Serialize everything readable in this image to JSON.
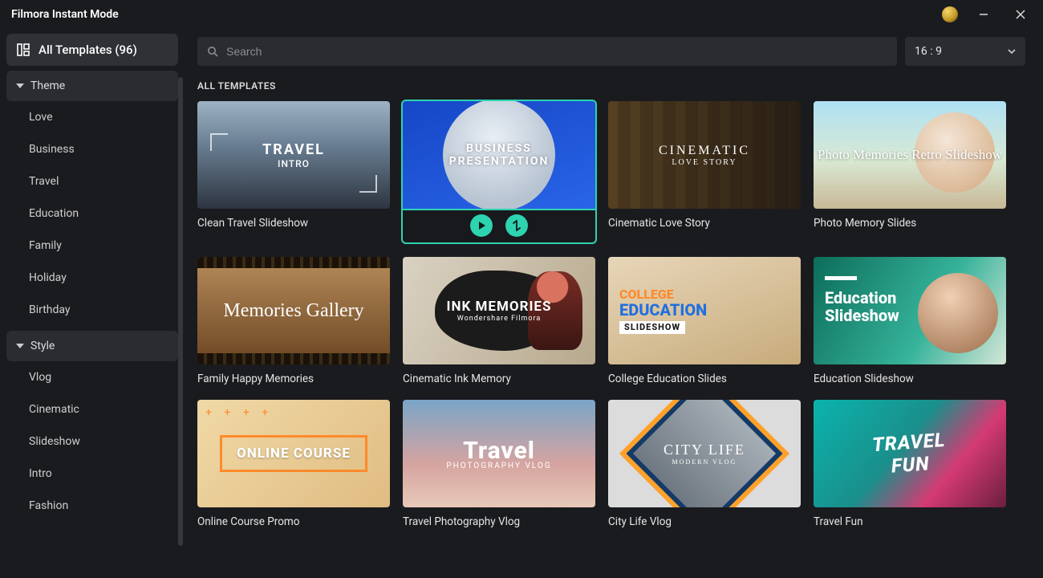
{
  "app_title": "Filmora Instant Mode",
  "search": {
    "placeholder": "Search"
  },
  "ratio": {
    "value": "16 : 9"
  },
  "sidebar": {
    "all": "All Templates (96)",
    "theme_label": "Theme",
    "style_label": "Style",
    "theme_items": [
      "Love",
      "Business",
      "Travel",
      "Education",
      "Family",
      "Holiday",
      "Birthday"
    ],
    "style_items": [
      "Vlog",
      "Cinematic",
      "Slideshow",
      "Intro",
      "Fashion"
    ]
  },
  "section_title": "ALL TEMPLATES",
  "templates": [
    {
      "name": "Clean Travel Slideshow",
      "overlay1": "TRAVEL",
      "overlay2": "INTRO",
      "selected": false
    },
    {
      "name": "Business Presentation",
      "overlay1": "BUSINESS",
      "overlay2": "PRESENTATION",
      "selected": true
    },
    {
      "name": "Cinematic Love Story",
      "overlay1": "CINEMATIC",
      "overlay2": "LOVE STORY",
      "selected": false
    },
    {
      "name": "Photo Memory Slides",
      "overlay1": "Photo Memories Retro Slideshow",
      "selected": false
    },
    {
      "name": "Family Happy Memories",
      "overlay1": "Memories Gallery",
      "selected": false
    },
    {
      "name": "Cinematic Ink Memory",
      "overlay1": "INK MEMORIES",
      "overlay2": "Wondershare Filmora",
      "selected": false
    },
    {
      "name": "College Education Slides",
      "overlay1": "COLLEGE",
      "overlay2": "EDUCATION",
      "overlay3": "SLIDESHOW",
      "selected": false
    },
    {
      "name": "Education Slideshow",
      "overlay1": "Education",
      "overlay2": "Slideshow",
      "selected": false
    },
    {
      "name": "Online Course Promo",
      "overlay1": "ONLINE COURSE",
      "selected": false
    },
    {
      "name": "Travel Photography Vlog",
      "overlay1": "Travel",
      "overlay2": "PHOTOGRAPHY VLOG",
      "selected": false
    },
    {
      "name": "City Life Vlog",
      "overlay1": "CITY LIFE",
      "overlay2": "MODERN VLOG",
      "selected": false
    },
    {
      "name": "Travel Fun",
      "overlay1": "TRAVEL",
      "overlay2": "FUN",
      "selected": false
    }
  ]
}
